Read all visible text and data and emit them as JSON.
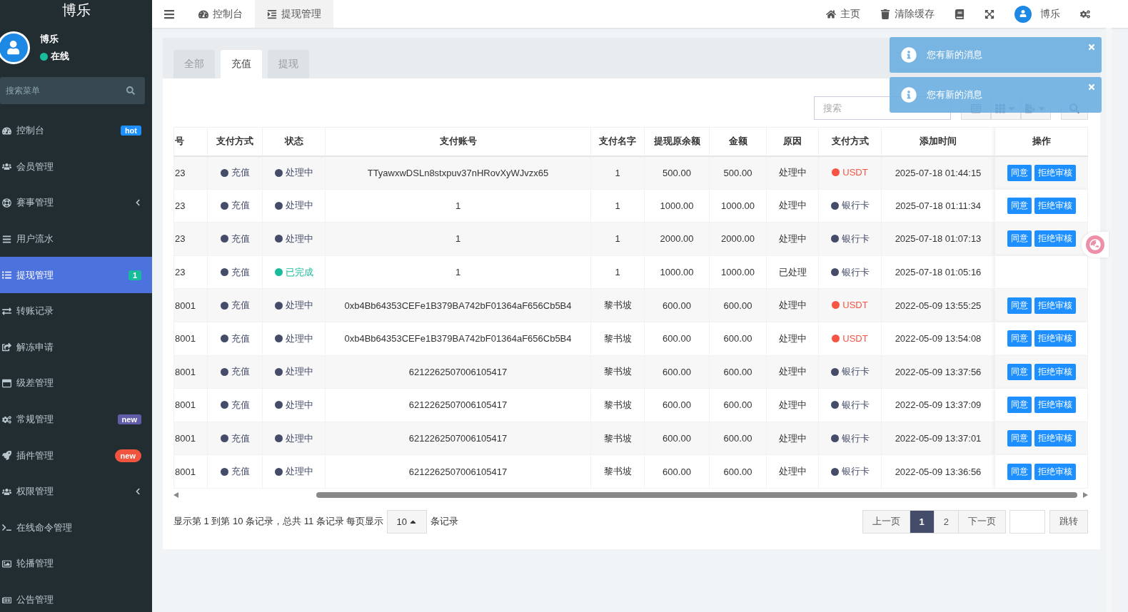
{
  "sidebar": {
    "brand": "博乐",
    "user": {
      "name": "博乐",
      "status": "在线",
      "online": true
    },
    "search": {
      "placeholder": "搜索菜单"
    },
    "items": [
      {
        "label": "控制台",
        "selected": false,
        "kind": "link",
        "badge": {
          "text": "hot",
          "kind": "label",
          "color": "#1e8fff"
        }
      },
      {
        "label": "会员管理",
        "selected": false,
        "kind": "link"
      },
      {
        "label": "赛事管理",
        "selected": false,
        "kind": "group"
      },
      {
        "label": "用户流水",
        "selected": false,
        "kind": "link"
      },
      {
        "label": "提现管理",
        "selected": true,
        "kind": "link",
        "badge": {
          "text": "1",
          "kind": "label",
          "color": "#18bc9c"
        }
      },
      {
        "label": "转账记录",
        "selected": false,
        "kind": "link"
      },
      {
        "label": "解冻申请",
        "selected": false,
        "kind": "link"
      },
      {
        "label": "级差管理",
        "selected": false,
        "kind": "link"
      },
      {
        "label": "常规管理",
        "selected": false,
        "kind": "link",
        "badge": {
          "text": "new",
          "kind": "label",
          "color": "#605ca8"
        }
      },
      {
        "label": "插件管理",
        "selected": false,
        "kind": "link",
        "badge": {
          "text": "new",
          "kind": "pill",
          "color": "#f0533e"
        }
      },
      {
        "label": "权限管理",
        "selected": false,
        "kind": "group"
      },
      {
        "label": "在线命令管理",
        "selected": false,
        "kind": "link"
      },
      {
        "label": "轮播管理",
        "selected": false,
        "kind": "link"
      },
      {
        "label": "公告管理",
        "selected": false,
        "kind": "link"
      }
    ]
  },
  "topbar": {
    "tabs": [
      {
        "label": "控制台",
        "selected": false
      },
      {
        "label": "提现管理",
        "selected": true
      }
    ],
    "links": [
      {
        "label": "主页"
      },
      {
        "label": "清除缓存"
      }
    ],
    "user": "博乐"
  },
  "panel": {
    "tabs": [
      {
        "label": "全部",
        "selected": false
      },
      {
        "label": "充值",
        "selected": true
      },
      {
        "label": "提现",
        "selected": false
      }
    ],
    "search": {
      "placeholder": "搜索"
    },
    "table": {
      "columns": [
        "号",
        "支付方式",
        "状态",
        "支付账号",
        "支付名字",
        "提现原余额",
        "金额",
        "原因",
        "支付方式",
        "添加时间",
        "操作"
      ],
      "rows": [
        {
          "id": "23",
          "type": "充值",
          "status": {
            "text": "处理中",
            "kind": "pending"
          },
          "account": "TTyawxwDSLn8stxpuv37nHRovXyWJvzx65",
          "name": "1",
          "original": "500.00",
          "amount": "500.00",
          "reason": "处理中",
          "method": {
            "text": "USDT",
            "kind": "usdt"
          },
          "time": "2025-07-18 01:44:15",
          "actions": [
            "同意",
            "拒绝审核"
          ]
        },
        {
          "id": "23",
          "type": "充值",
          "status": {
            "text": "处理中",
            "kind": "pending"
          },
          "account": "1",
          "name": "1",
          "original": "1000.00",
          "amount": "1000.00",
          "reason": "处理中",
          "method": {
            "text": "银行卡",
            "kind": "bank"
          },
          "time": "2025-07-18 01:11:34",
          "actions": [
            "同意",
            "拒绝审核"
          ]
        },
        {
          "id": "23",
          "type": "充值",
          "status": {
            "text": "处理中",
            "kind": "pending"
          },
          "account": "1",
          "name": "1",
          "original": "2000.00",
          "amount": "2000.00",
          "reason": "处理中",
          "method": {
            "text": "银行卡",
            "kind": "bank"
          },
          "time": "2025-07-18 01:07:13",
          "actions": [
            "同意",
            "拒绝审核"
          ]
        },
        {
          "id": "23",
          "type": "充值",
          "status": {
            "text": "已完成",
            "kind": "done"
          },
          "account": "1",
          "name": "1",
          "original": "1000.00",
          "amount": "1000.00",
          "reason": "已处理",
          "method": {
            "text": "银行卡",
            "kind": "bank"
          },
          "time": "2025-07-18 01:05:16"
        },
        {
          "id": "8001",
          "type": "充值",
          "status": {
            "text": "处理中",
            "kind": "pending"
          },
          "account": "0xb4Bb64353CEFe1B379BA742bF01364aF656Cb5B4",
          "name": "黎书坡",
          "original": "600.00",
          "amount": "600.00",
          "reason": "处理中",
          "method": {
            "text": "USDT",
            "kind": "usdt"
          },
          "time": "2022-05-09 13:55:25",
          "actions": [
            "同意",
            "拒绝审核"
          ]
        },
        {
          "id": "8001",
          "type": "充值",
          "status": {
            "text": "处理中",
            "kind": "pending"
          },
          "account": "0xb4Bb64353CEFe1B379BA742bF01364aF656Cb5B4",
          "name": "黎书坡",
          "original": "600.00",
          "amount": "600.00",
          "reason": "处理中",
          "method": {
            "text": "USDT",
            "kind": "usdt"
          },
          "time": "2022-05-09 13:54:08",
          "actions": [
            "同意",
            "拒绝审核"
          ]
        },
        {
          "id": "8001",
          "type": "充值",
          "status": {
            "text": "处理中",
            "kind": "pending"
          },
          "account": "6212262507006105417",
          "name": "黎书坡",
          "original": "600.00",
          "amount": "600.00",
          "reason": "处理中",
          "method": {
            "text": "银行卡",
            "kind": "bank"
          },
          "time": "2022-05-09 13:37:56",
          "actions": [
            "同意",
            "拒绝审核"
          ]
        },
        {
          "id": "8001",
          "type": "充值",
          "status": {
            "text": "处理中",
            "kind": "pending"
          },
          "account": "6212262507006105417",
          "name": "黎书坡",
          "original": "600.00",
          "amount": "600.00",
          "reason": "处理中",
          "method": {
            "text": "银行卡",
            "kind": "bank"
          },
          "time": "2022-05-09 13:37:09",
          "actions": [
            "同意",
            "拒绝审核"
          ]
        },
        {
          "id": "8001",
          "type": "充值",
          "status": {
            "text": "处理中",
            "kind": "pending"
          },
          "account": "6212262507006105417",
          "name": "黎书坡",
          "original": "600.00",
          "amount": "600.00",
          "reason": "处理中",
          "method": {
            "text": "银行卡",
            "kind": "bank"
          },
          "time": "2022-05-09 13:37:01",
          "actions": [
            "同意",
            "拒绝审核"
          ]
        },
        {
          "id": "8001",
          "type": "充值",
          "status": {
            "text": "处理中",
            "kind": "pending"
          },
          "account": "6212262507006105417",
          "name": "黎书坡",
          "original": "600.00",
          "amount": "600.00",
          "reason": "处理中",
          "method": {
            "text": "银行卡",
            "kind": "bank"
          },
          "time": "2022-05-09 13:36:56",
          "actions": [
            "同意",
            "拒绝审核"
          ]
        }
      ]
    },
    "footer": {
      "summary": "显示第 1 到第 10 条记录，总共 11 条记录 每页显示",
      "page_size": "10",
      "suffix": "条记录"
    },
    "pagination": {
      "prev": "上一页",
      "pages": [
        {
          "label": "1",
          "selected": true
        },
        {
          "label": "2",
          "selected": false
        }
      ],
      "next": "下一页",
      "go": "跳转"
    }
  },
  "toasts": [
    {
      "message": "您有新的消息"
    },
    {
      "message": "您有新的消息"
    }
  ]
}
